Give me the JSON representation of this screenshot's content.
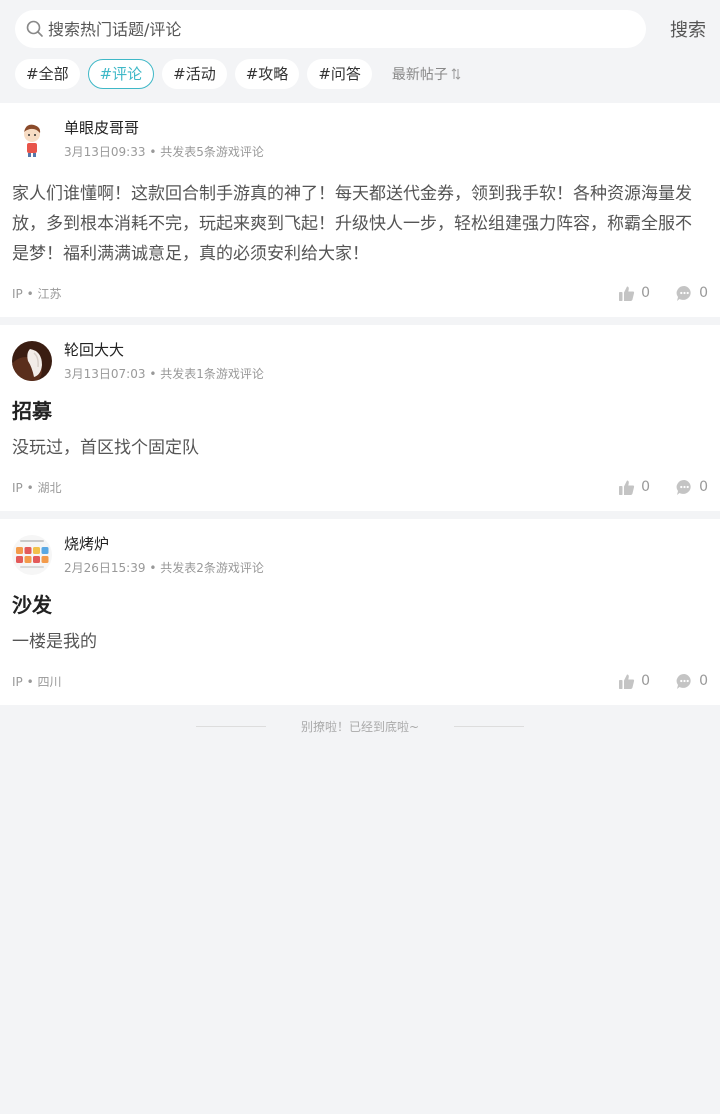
{
  "search": {
    "placeholder": "搜索热门话题/评论",
    "button_label": "搜索"
  },
  "tabs": [
    {
      "label": "#全部",
      "active": false
    },
    {
      "label": "#评论",
      "active": true
    },
    {
      "label": "#活动",
      "active": false
    },
    {
      "label": "#攻略",
      "active": false
    },
    {
      "label": "#问答",
      "active": false
    }
  ],
  "sort": {
    "label": "最新帖子"
  },
  "posts": [
    {
      "username": "单眼皮哥哥",
      "date": "3月13日09:33",
      "sep": "•",
      "count_text": "共发表5条游戏评论",
      "title": "",
      "content": "家人们谁懂啊！这款回合制手游真的神了！每天都送代金券，领到我手软！各种资源海量发放，多到根本消耗不完，玩起来爽到飞起！升级快人一步，轻松组建强力阵容，称霸全服不是梦！福利满满诚意足，真的必须安利给大家！",
      "ip_label": "IP",
      "ip_location": "江苏",
      "likes": "0",
      "comments": "0"
    },
    {
      "username": "轮回大大",
      "date": "3月13日07:03",
      "sep": "•",
      "count_text": "共发表1条游戏评论",
      "title": "招募",
      "content": "没玩过，首区找个固定队",
      "ip_label": "IP",
      "ip_location": "湖北",
      "likes": "0",
      "comments": "0"
    },
    {
      "username": "烧烤炉",
      "date": "2月26日15:39",
      "sep": "•",
      "count_text": "共发表2条游戏评论",
      "title": "沙发",
      "content": "一楼是我的",
      "ip_label": "IP",
      "ip_location": "四川",
      "likes": "0",
      "comments": "0"
    }
  ],
  "footer": {
    "end_text": "别撩啦！已经到底啦~"
  },
  "colors": {
    "accent": "#3fb8c7",
    "background": "#f3f4f6"
  }
}
